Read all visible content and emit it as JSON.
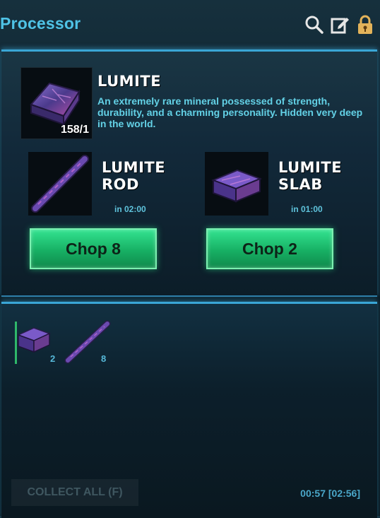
{
  "header": {
    "title": "Processor"
  },
  "icons": {
    "search": "search-icon",
    "edit": "edit-icon",
    "lock": "lock-icon"
  },
  "source": {
    "name": "LUMITE",
    "quantity": "158/1",
    "description": "An extremely rare mineral possessed of strength, durability, and a charming personality. Hidden very deep in the world."
  },
  "recipes": [
    {
      "name_line1": "LUMITE",
      "name_line2": "ROD",
      "time": "in 02:00",
      "button": "Chop 8"
    },
    {
      "name_line1": "LUMITE",
      "name_line2": "SLAB",
      "time": "in 01:00",
      "button": "Chop 2"
    }
  ],
  "output": [
    {
      "item": "lumite-slab",
      "count": "2"
    },
    {
      "item": "lumite-rod",
      "count": "8"
    }
  ],
  "footer": {
    "collect_label": "COLLECT ALL (F)",
    "timer": "00:57 [02:56]"
  },
  "colors": {
    "accent": "#4fc3e6",
    "button": "#1fc776",
    "panel_border": "#3aa6d6"
  }
}
